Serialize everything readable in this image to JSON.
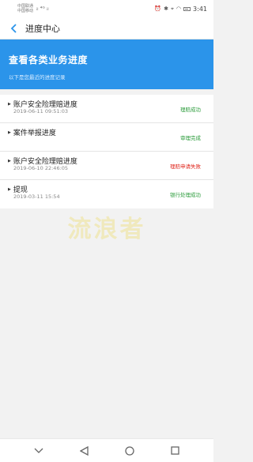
{
  "status_bar": {
    "carrier1": "中国联通",
    "carrier2": "中国移动",
    "signal_text": "ᵢₗ ⁴ᴳ ᵢₗ",
    "time": "3:41"
  },
  "header": {
    "title": "进度中心"
  },
  "banner": {
    "title": "查看各类业务进度",
    "subtitle": "以下是您最近的进度记录"
  },
  "records": [
    {
      "title": "账户安全险理赔进度",
      "date": "2019-06-11 09:51:03",
      "status": "理赔成功",
      "status_type": "success"
    },
    {
      "title": "案件举报进度",
      "date": "",
      "status": "审理完成",
      "status_type": "success"
    },
    {
      "title": "账户安全险理赔进度",
      "date": "2019-06-10 22:46:05",
      "status": "理赔申请失败",
      "status_type": "fail"
    },
    {
      "title": "提现",
      "date": "2019-03-11 15:54",
      "status": "银行处理成功",
      "status_type": "success"
    }
  ],
  "watermark": "流浪者",
  "colors": {
    "banner": "#2b94ea",
    "success": "#2a9b3a",
    "fail": "#e0261c"
  },
  "icons": {
    "back": "chevron-left-icon",
    "nav_collapse": "chevron-down-icon",
    "nav_back": "triangle-back-icon",
    "nav_home": "circle-home-icon",
    "nav_recent": "square-recent-icon"
  }
}
